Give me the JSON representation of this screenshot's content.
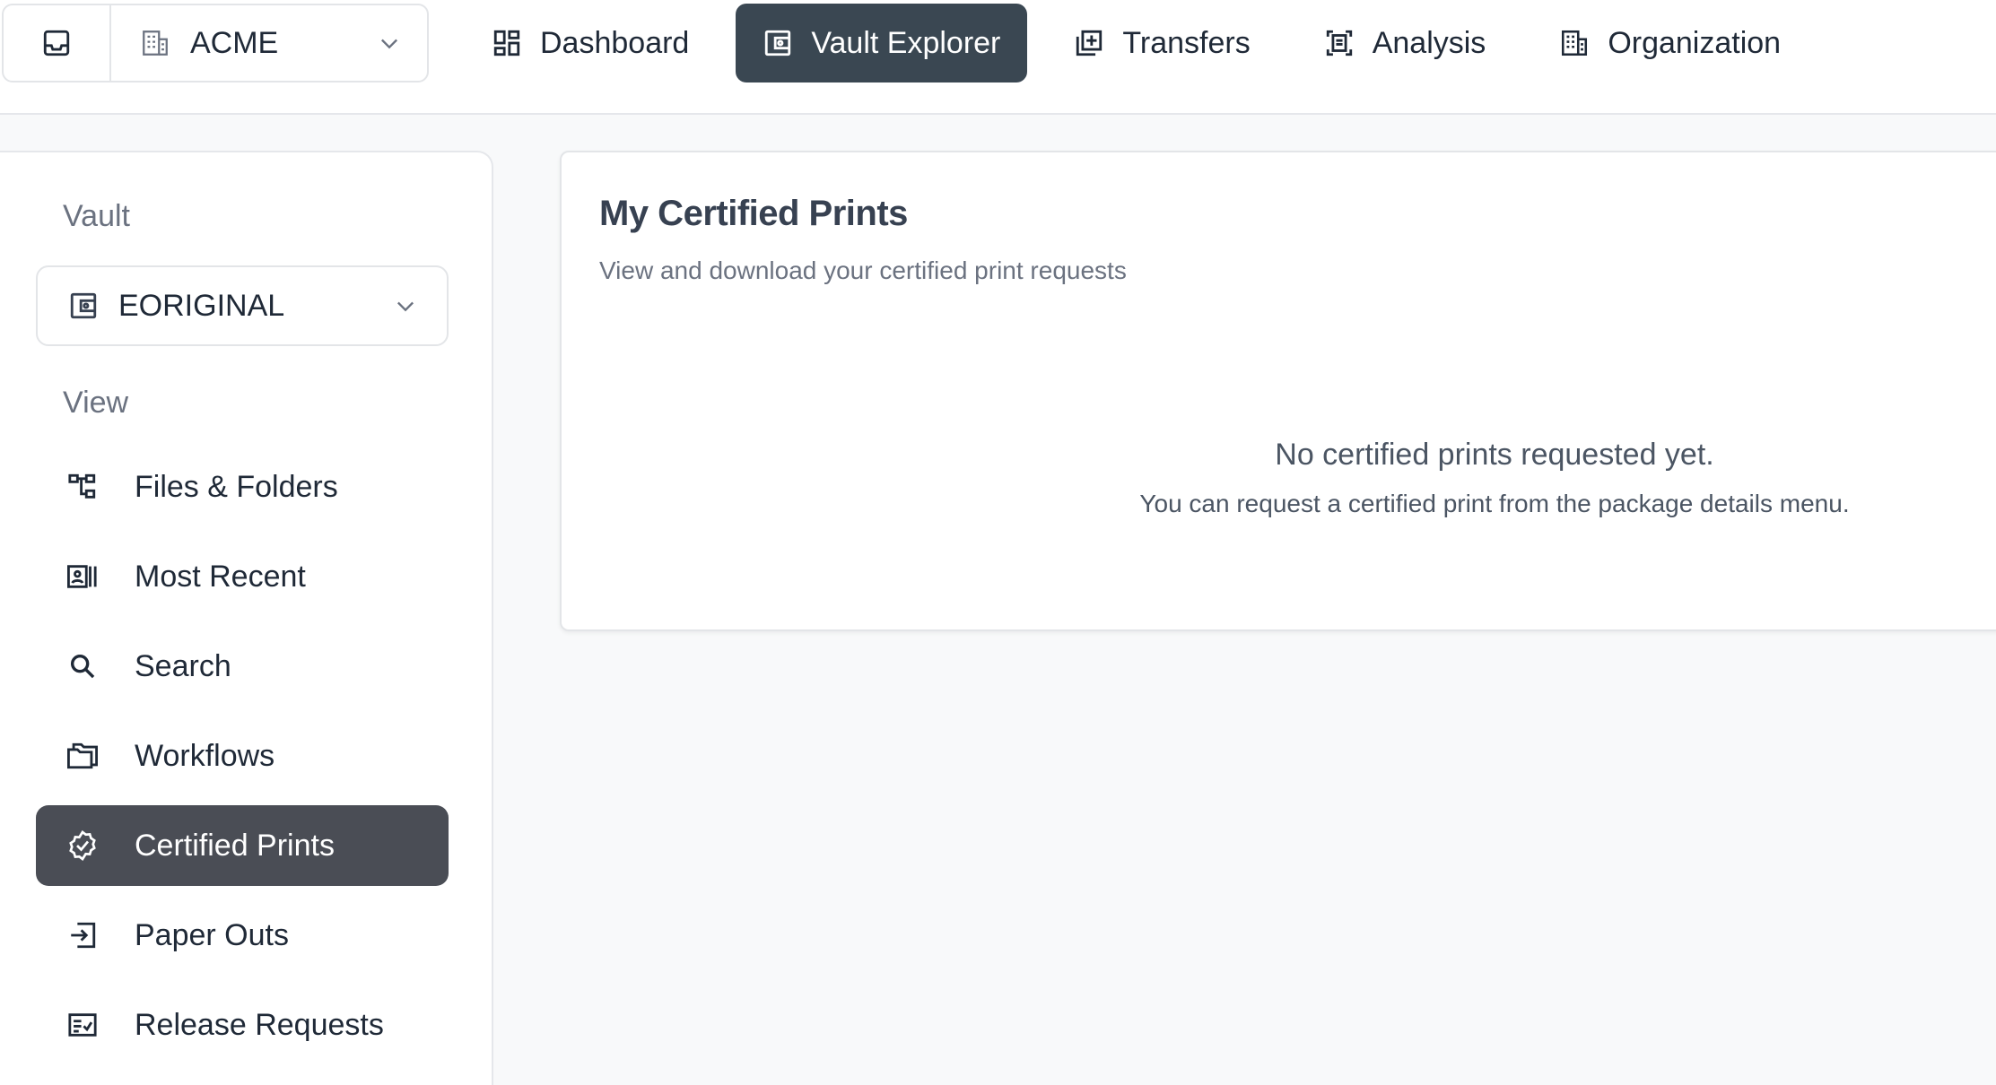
{
  "header": {
    "org_name": "ACME",
    "nav": [
      {
        "label": "Dashboard",
        "icon": "dashboard-icon"
      },
      {
        "label": "Vault Explorer",
        "icon": "vault-icon",
        "active": true
      },
      {
        "label": "Transfers",
        "icon": "transfers-icon"
      },
      {
        "label": "Analysis",
        "icon": "analysis-icon"
      },
      {
        "label": "Organization",
        "icon": "building-icon"
      }
    ]
  },
  "sidebar": {
    "vault_label": "Vault",
    "vault_selected": "EORIGINAL",
    "view_label": "View",
    "items": [
      {
        "label": "Files & Folders",
        "icon": "folder-tree-icon"
      },
      {
        "label": "Most Recent",
        "icon": "recent-icon"
      },
      {
        "label": "Search",
        "icon": "search-icon"
      },
      {
        "label": "Workflows",
        "icon": "workflows-icon"
      },
      {
        "label": "Certified Prints",
        "icon": "certified-badge-icon",
        "active": true
      },
      {
        "label": "Paper Outs",
        "icon": "paper-out-icon"
      },
      {
        "label": "Release Requests",
        "icon": "release-request-icon"
      }
    ]
  },
  "main": {
    "title": "My Certified Prints",
    "subtitle": "View and download your certified print requests",
    "empty_title": "No certified prints requested yet.",
    "empty_message": "You can request a certified print from the package details menu."
  },
  "colors": {
    "nav_active_bg": "#3a4752",
    "sidebar_active_bg": "#4a4d55",
    "page_bg": "#f8f9fa"
  }
}
